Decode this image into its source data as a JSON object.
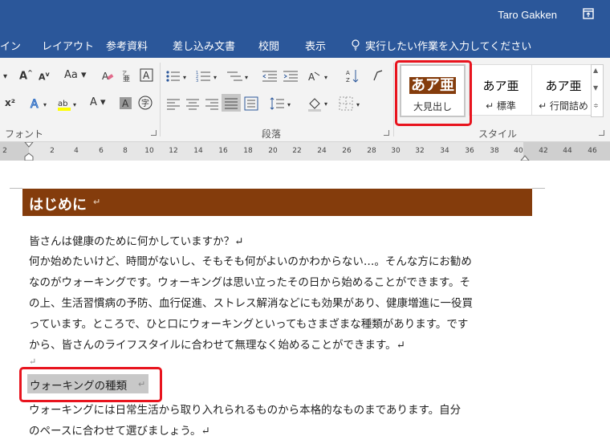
{
  "titlebar": {
    "user": "Taro Gakken"
  },
  "tabs": [
    "イン",
    "レイアウト",
    "参考資料",
    "差し込み文書",
    "校閲",
    "表示"
  ],
  "tell_me": "実行したい作業を入力してください",
  "ribbon": {
    "font_group_label": "フォント",
    "paragraph_group_label": "段落",
    "styles_group_label": "スタイル",
    "font_buttons": {
      "grow": "A",
      "shrink": "A",
      "case": "Aa",
      "superscript": "x²",
      "font_color": "A"
    },
    "styles": [
      {
        "sample": "あア亜",
        "name": "大見出し"
      },
      {
        "sample": "あア亜",
        "name": "↵ 標準"
      },
      {
        "sample": "あア亜",
        "name": "↵ 行間詰め"
      }
    ]
  },
  "ruler": [
    "2",
    "2",
    "4",
    "6",
    "8",
    "10",
    "12",
    "14",
    "16",
    "18",
    "20",
    "22",
    "24",
    "26",
    "28",
    "30",
    "32",
    "34",
    "36",
    "38",
    "40",
    "42",
    "44",
    "46"
  ],
  "document": {
    "heading": "はじめに",
    "lines": [
      "皆さんは健康のために何かしていますか？↵",
      "何か始めたいけど、時間がないし、そもそも何がよいのかわからない…。そんな方にお勧め",
      "なのがウォーキングです。ウォーキングは思い立ったその日から始めることができます。そ",
      "の上、生活習慣病の予防、血行促進、ストレス解消などにも効果があり、健康増進に一役買",
      "っています。ところで、ひと口にウォーキングといってもさまざまな種類があります。です",
      "から、皆さんのライフスタイルに合わせて無理なく始めることができます。↵"
    ],
    "empty_mark": "↵",
    "selected_heading": "ウォーキングの種類",
    "selected_mark": "↵",
    "lines2": [
      "ウォーキングには日常生活から取り入れられるものから本格的なものまであります。自分",
      "のペースに合わせて選びましょう。↵"
    ]
  }
}
